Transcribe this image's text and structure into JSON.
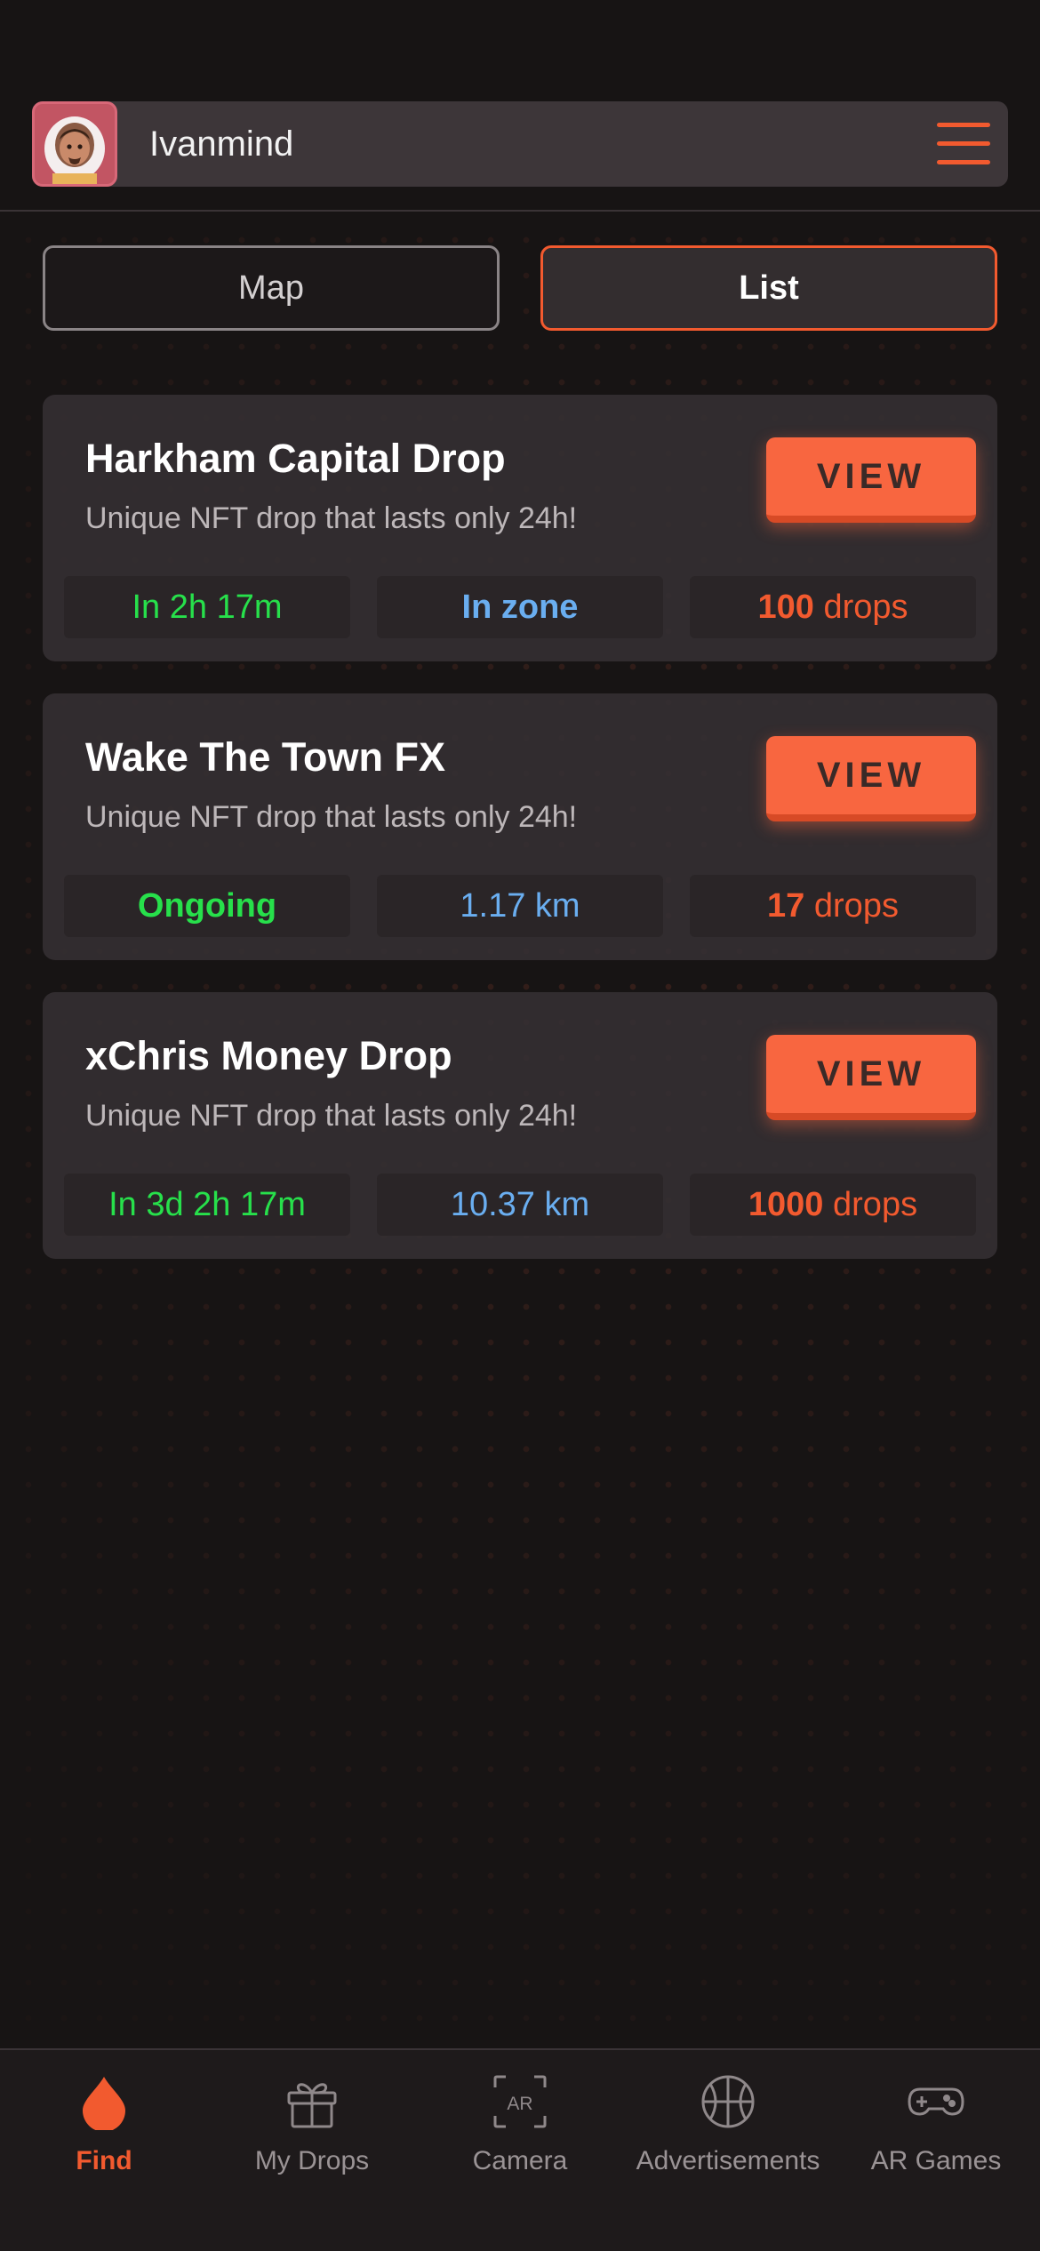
{
  "header": {
    "username": "Ivanmind",
    "avatar_icon": "astronaut-avatar",
    "menu_icon": "hamburger-menu-icon"
  },
  "toggle": {
    "map_label": "Map",
    "list_label": "List",
    "selected": "List"
  },
  "drops": [
    {
      "title": "Harkham Capital Drop",
      "subtitle": "Unique NFT drop that lasts only 24h!",
      "button_label": "VIEW",
      "time": "In 2h 17m",
      "distance": "In zone",
      "count": "100",
      "count_unit": "drops"
    },
    {
      "title": "Wake The Town FX",
      "subtitle": "Unique NFT drop that lasts only 24h!",
      "button_label": "VIEW",
      "time": "Ongoing",
      "distance": "1.17 km",
      "count": "17",
      "count_unit": "drops"
    },
    {
      "title": "xChris Money Drop",
      "subtitle": "Unique NFT drop that lasts only 24h!",
      "button_label": "VIEW",
      "time": "In 3d 2h 17m",
      "distance": "10.37 km",
      "count": "1000",
      "count_unit": "drops"
    }
  ],
  "tabbar": {
    "items": [
      {
        "label": "Find",
        "icon": "drop-icon",
        "active": true
      },
      {
        "label": "My Drops",
        "icon": "gift-icon",
        "active": false
      },
      {
        "label": "Camera",
        "icon": "ar-camera-icon",
        "active": false
      },
      {
        "label": "Advertisements",
        "icon": "basketball-icon",
        "active": false
      },
      {
        "label": "AR Games",
        "icon": "gamepad-icon",
        "active": false
      }
    ]
  },
  "colors": {
    "accent": "#f25a2f",
    "background": "#171414",
    "card": "#342f32",
    "green": "#27e04b",
    "blue": "#6aaef0"
  }
}
